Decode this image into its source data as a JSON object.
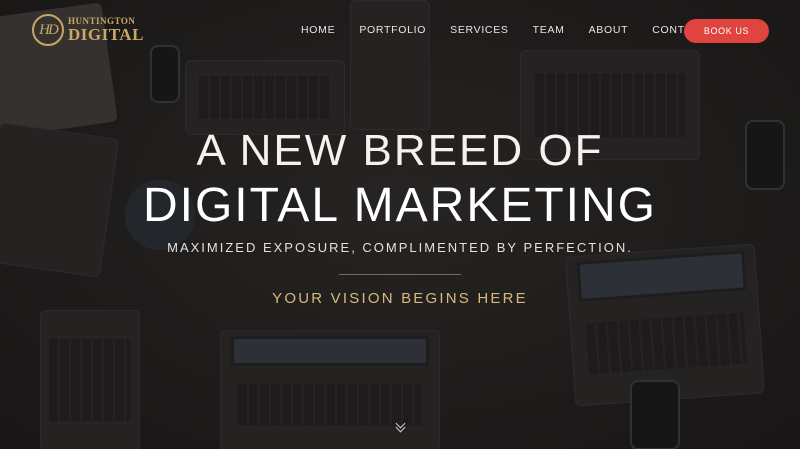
{
  "brand": {
    "logo_monogram": "HD",
    "logo_top": "HUNTINGTON",
    "logo_bottom": "DIGITAL",
    "accent_color": "#c9a866"
  },
  "nav": {
    "items": [
      {
        "label": "HOME"
      },
      {
        "label": "PORTFOLIO"
      },
      {
        "label": "SERVICES"
      },
      {
        "label": "TEAM"
      },
      {
        "label": "ABOUT"
      },
      {
        "label": "CONTACT"
      }
    ],
    "cta_label": "BOOK US",
    "cta_color": "#e0443f"
  },
  "hero": {
    "headline_line1": "A NEW BREED OF",
    "headline_line2": "DIGITAL MARKETING",
    "subtitle": "MAXIMIZED EXPOSURE, COMPLIMENTED BY PERFECTION.",
    "tagline": "YOUR VISION BEGINS HERE",
    "tagline_color": "#d8b97a",
    "scroll_icon": "double-chevron-down-icon"
  }
}
